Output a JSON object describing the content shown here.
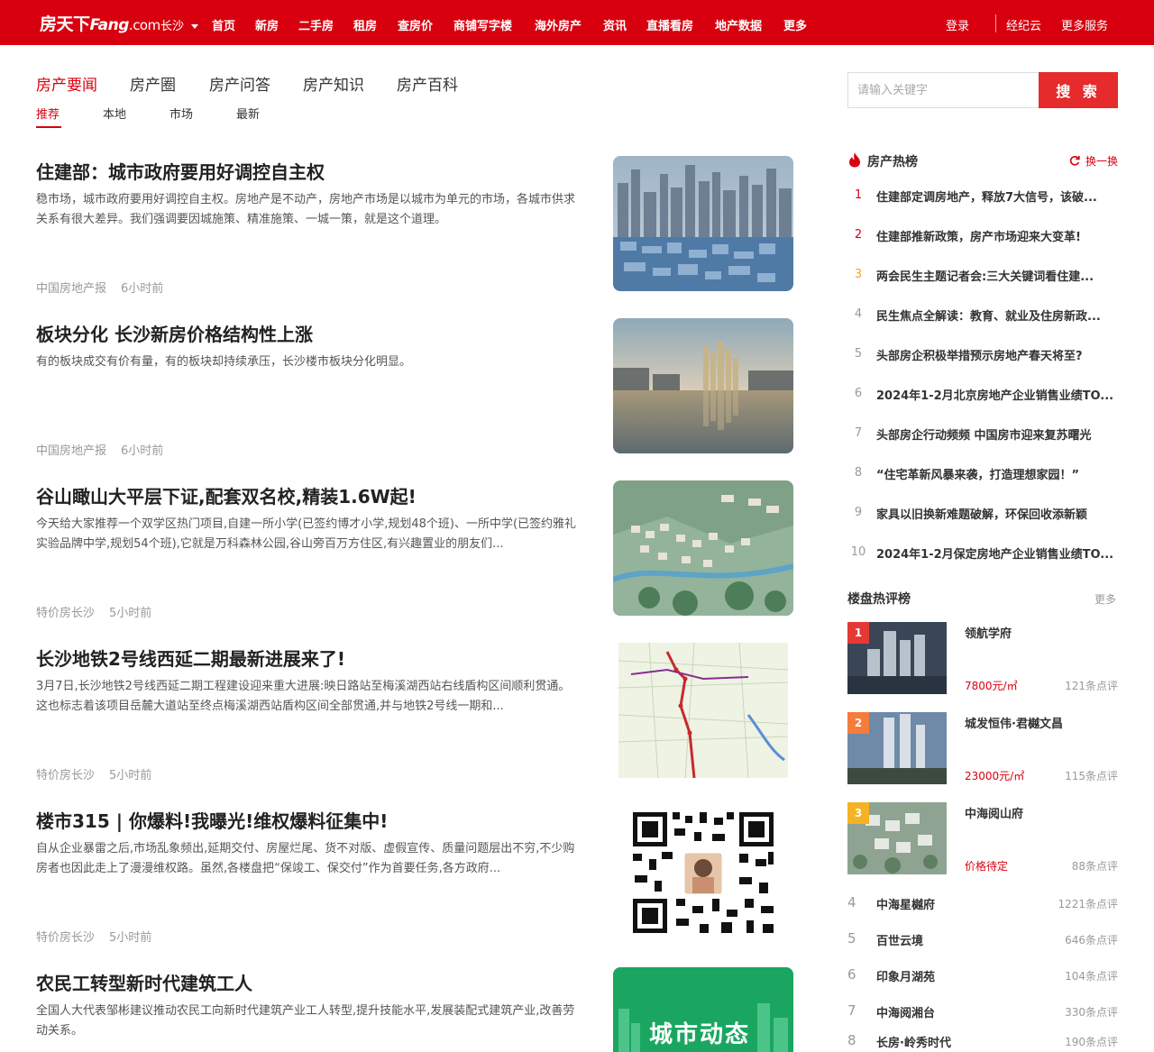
{
  "header": {
    "logo_cn": "房天下",
    "logo_en": "Fang",
    "logo_com": ".com",
    "city": "长沙",
    "nav": [
      "首页",
      "新房",
      "二手房",
      "租房",
      "查房价",
      "商铺写字楼",
      "海外房产",
      "资讯",
      "直播看房",
      "地产数据",
      "更多"
    ],
    "login": "登录",
    "broker": "经纪云",
    "more_services": "更多服务"
  },
  "tabs": [
    "房产要闻",
    "房产圈",
    "房产问答",
    "房产知识",
    "房产百科"
  ],
  "subtabs": [
    "推荐",
    "本地",
    "市场",
    "最新"
  ],
  "articles": [
    {
      "title": "住建部：城市政府要用好调控自主权",
      "desc": "稳市场，城市政府要用好调控自主权。房地产是不动产，房地产市场是以城市为单元的市场，各城市供求关系有很大差异。我们强调要因城施策、精准施策、一城一策，就是这个道理。",
      "source": "中国房地产报",
      "time": "6小时前"
    },
    {
      "title": "板块分化 长沙新房价格结构性上涨",
      "desc": "有的板块成交有价有量，有的板块却持续承压，长沙楼市板块分化明显。",
      "source": "中国房地产报",
      "time": "6小时前"
    },
    {
      "title": "谷山瞰山大平层下证,配套双名校,精装1.6W起!",
      "desc": "今天给大家推荐一个双学区热门项目,自建一所小学(已签约博才小学,规划48个班)、一所中学(已签约雅礼实验品牌中学,规划54个班),它就是万科森林公园,谷山旁百万方住区,有兴趣置业的朋友们...",
      "source": "特价房长沙",
      "time": "5小时前"
    },
    {
      "title": "长沙地铁2号线西延二期最新进展来了!",
      "desc": "3月7日,长沙地铁2号线西延二期工程建设迎来重大进展:映日路站至梅溪湖西站右线盾构区间顺利贯通。这也标志着该项目岳麓大道站至终点梅溪湖西站盾构区间全部贯通,并与地铁2号线一期和...",
      "source": "特价房长沙",
      "time": "5小时前"
    },
    {
      "title": "楼市315 | 你爆料!我曝光!维权爆料征集中!",
      "desc": "自从企业暴雷之后,市场乱象频出,延期交付、房屋烂尾、货不对版、虚假宣传、质量问题层出不穷,不少购房者也因此走上了漫漫维权路。虽然,各楼盘把“保竣工、保交付”作为首要任务,各方政府...",
      "source": "特价房长沙",
      "time": "5小时前"
    },
    {
      "title": "农民工转型新时代建筑工人",
      "desc": "全国人大代表邹彬建议推动农民工向新时代建筑产业工人转型,提升技能水平,发展装配式建筑产业,改善劳动关系。",
      "source": "",
      "time": "",
      "thumb_text": "城市动态"
    }
  ],
  "search": {
    "placeholder": "请输入关键字",
    "button": "搜 索"
  },
  "hot": {
    "title": "房产热榜",
    "refresh": "换一换",
    "items": [
      "住建部定调房地产，释放7大信号，该破...",
      "住建部推新政策，房产市场迎来大变革!",
      "两会民生主题记者会:三大关键词看住建...",
      "民生焦点全解读：教育、就业及住房新政...",
      "头部房企积极举措预示房地产春天将至?",
      "2024年1-2月北京房地产企业销售业绩TO...",
      "头部房企行动频频 中国房市迎来复苏曙光",
      "“住宅革新风暴来袭，打造理想家园！”",
      "家具以旧换新难题破解，环保回收添新颖",
      "2024年1-2月保定房地产企业销售业绩TO..."
    ]
  },
  "ranking": {
    "title": "楼盘热评榜",
    "more": "更多",
    "top": [
      {
        "rank": "1",
        "name": "领航学府",
        "price": "7800元/㎡",
        "reviews": "121条点评"
      },
      {
        "rank": "2",
        "name": "城发恒伟·君樾文昌",
        "price": "23000元/㎡",
        "reviews": "115条点评"
      },
      {
        "rank": "3",
        "name": "中海阅山府",
        "price": "价格待定",
        "reviews": "88条点评"
      }
    ],
    "rest": [
      {
        "rank": "4",
        "name": "中海星樾府",
        "reviews": "1221条点评"
      },
      {
        "rank": "5",
        "name": "百世云境",
        "reviews": "646条点评"
      },
      {
        "rank": "6",
        "name": "印象月湖苑",
        "reviews": "104条点评"
      },
      {
        "rank": "7",
        "name": "中海阅湘台",
        "reviews": "330条点评"
      },
      {
        "rank": "8",
        "name": "长房·岭秀时代",
        "reviews": "190条点评"
      }
    ]
  },
  "colors": {
    "brand_red": "#d8000f",
    "rank1": "#e53935",
    "rank2": "#f57c3a",
    "rank3": "#f5b323"
  }
}
